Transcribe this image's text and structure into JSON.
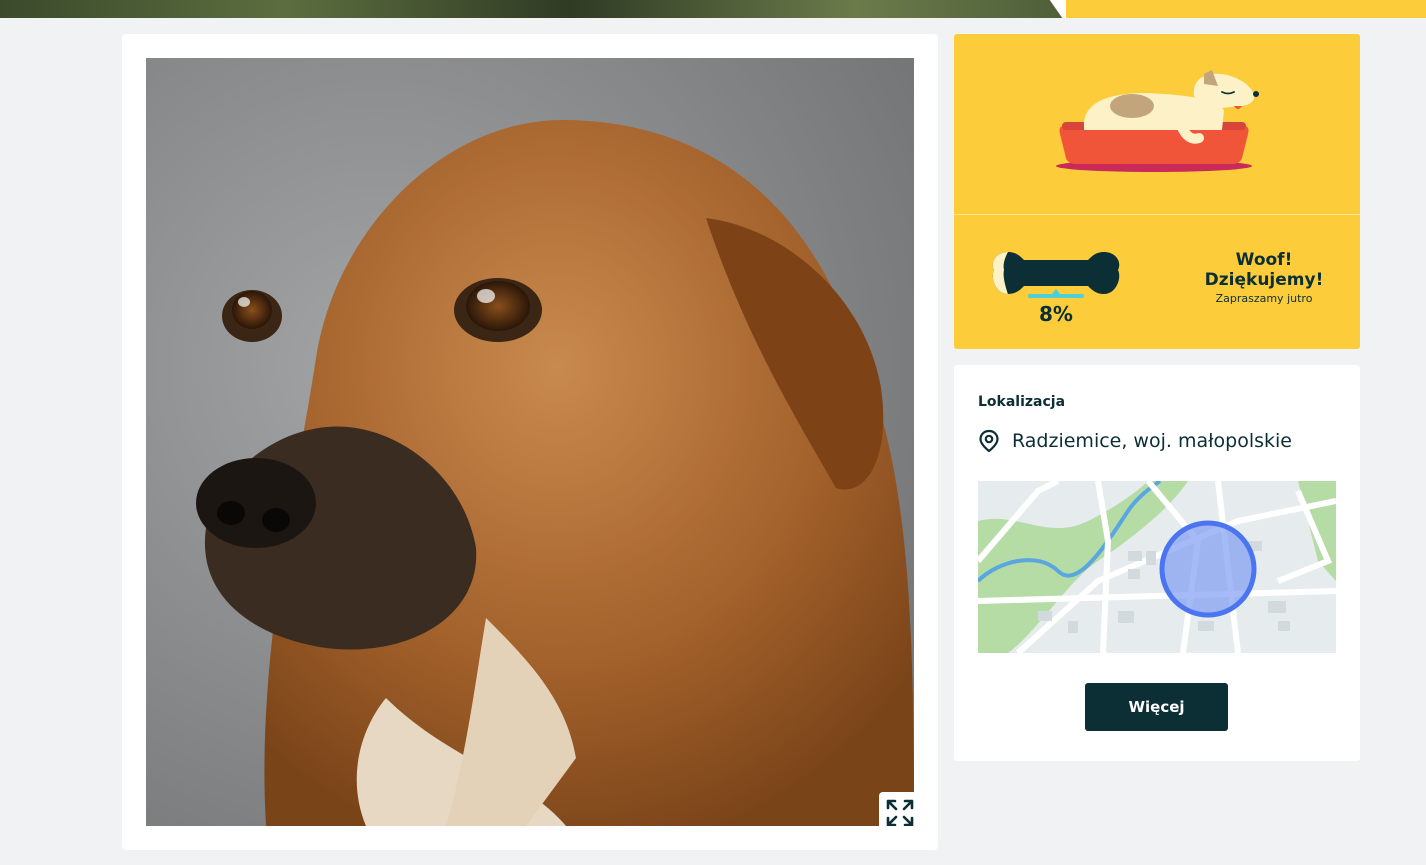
{
  "status": {
    "progress_percent": 8,
    "progress_label": "8%",
    "title_line1": "Woof!",
    "title_line2": "Dziękujemy!",
    "subtitle": "Zapraszamy jutro"
  },
  "location": {
    "heading": "Lokalizacja",
    "place": "Radziemice, woj. małopolskie"
  },
  "actions": {
    "more_label": "Więcej"
  },
  "colors": {
    "accent_yellow": "#fccc3a",
    "dark_teal": "#0b2f35",
    "map_circle": "#4a74f0"
  },
  "icons": {
    "expand": "expand-arrows-icon",
    "location": "location-pin-icon",
    "sleeping_dog": "sleeping-dog-illustration",
    "bone": "bone-progress-icon"
  }
}
